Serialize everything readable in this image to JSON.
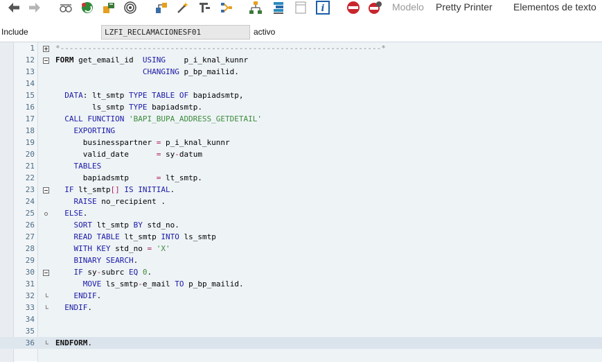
{
  "toolbar": {
    "icons": [
      "back-arrow-icon",
      "forward-arrow-icon",
      "display-change-icon",
      "other-object-icon",
      "activate-icon",
      "check-icon",
      "where-used-icon",
      "test-icon",
      "pattern-icon",
      "navigation-icon",
      "hierarchy-icon",
      "stack-icon",
      "frame-icon",
      "info-icon",
      "breakpoint-icon",
      "external-breakpoint-icon"
    ],
    "modelo_label": "Modelo",
    "pretty_printer_label": "Pretty Printer",
    "elementos_label": "Elementos de texto"
  },
  "info": {
    "include_label": "Include",
    "include_value": "LZFI_RECLAMACIONESF01",
    "status": "activo"
  },
  "editor": {
    "lines": [
      {
        "no": "1",
        "fold": "plus",
        "tokens": [
          {
            "t": "*----------------------------------------------------------------------*",
            "c": "cmt"
          }
        ]
      },
      {
        "no": "12",
        "fold": "minus",
        "tokens": [
          {
            "t": "FORM ",
            "c": "ef"
          },
          {
            "t": "get_email_id  ",
            "c": "black"
          },
          {
            "t": "USING",
            "c": "kw"
          },
          {
            "t": "    p_i_knal_kunnr",
            "c": "black"
          }
        ]
      },
      {
        "no": "13",
        "fold": "",
        "tokens": [
          {
            "t": "                   ",
            "c": "black"
          },
          {
            "t": "CHANGING",
            "c": "kw"
          },
          {
            "t": " p_bp_mailid.",
            "c": "black"
          }
        ]
      },
      {
        "no": "14",
        "fold": "",
        "tokens": []
      },
      {
        "no": "15",
        "fold": "",
        "tokens": [
          {
            "t": "  ",
            "c": "black"
          },
          {
            "t": "DATA",
            "c": "kw"
          },
          {
            "t": ": lt_smtp ",
            "c": "black"
          },
          {
            "t": "TYPE TABLE OF",
            "c": "kw"
          },
          {
            "t": " bapiadsmtp,",
            "c": "black"
          }
        ]
      },
      {
        "no": "16",
        "fold": "",
        "tokens": [
          {
            "t": "        ls_smtp ",
            "c": "black"
          },
          {
            "t": "TYPE",
            "c": "kw"
          },
          {
            "t": " bapiadsmtp.",
            "c": "black"
          }
        ]
      },
      {
        "no": "17",
        "fold": "",
        "tokens": [
          {
            "t": "  ",
            "c": "black"
          },
          {
            "t": "CALL FUNCTION",
            "c": "kw"
          },
          {
            "t": " ",
            "c": "black"
          },
          {
            "t": "'BAPI_BUPA_ADDRESS_GETDETAIL'",
            "c": "str"
          }
        ]
      },
      {
        "no": "18",
        "fold": "",
        "tokens": [
          {
            "t": "    ",
            "c": "black"
          },
          {
            "t": "EXPORTING",
            "c": "kw"
          }
        ]
      },
      {
        "no": "19",
        "fold": "",
        "tokens": [
          {
            "t": "      businesspartner ",
            "c": "black"
          },
          {
            "t": "=",
            "c": "op"
          },
          {
            "t": " p_i_knal_kunnr",
            "c": "black"
          }
        ]
      },
      {
        "no": "20",
        "fold": "",
        "tokens": [
          {
            "t": "      valid_date      ",
            "c": "black"
          },
          {
            "t": "=",
            "c": "op"
          },
          {
            "t": " sy",
            "c": "black"
          },
          {
            "t": "-",
            "c": "op"
          },
          {
            "t": "datum",
            "c": "black"
          }
        ]
      },
      {
        "no": "21",
        "fold": "",
        "tokens": [
          {
            "t": "    ",
            "c": "black"
          },
          {
            "t": "TABLES",
            "c": "kw"
          }
        ]
      },
      {
        "no": "22",
        "fold": "",
        "tokens": [
          {
            "t": "      bapiadsmtp      ",
            "c": "black"
          },
          {
            "t": "=",
            "c": "op"
          },
          {
            "t": " lt_smtp.",
            "c": "black"
          }
        ]
      },
      {
        "no": "23",
        "fold": "minus",
        "tokens": [
          {
            "t": "  ",
            "c": "black"
          },
          {
            "t": "IF",
            "c": "kw"
          },
          {
            "t": " lt_smtp",
            "c": "black"
          },
          {
            "t": "[]",
            "c": "op"
          },
          {
            "t": " ",
            "c": "black"
          },
          {
            "t": "IS INITIAL",
            "c": "kw"
          },
          {
            "t": ".",
            "c": "black"
          }
        ]
      },
      {
        "no": "24",
        "fold": "",
        "tokens": [
          {
            "t": "    ",
            "c": "black"
          },
          {
            "t": "RAISE",
            "c": "kw"
          },
          {
            "t": " no_recipient .",
            "c": "black"
          }
        ]
      },
      {
        "no": "25",
        "fold": "dot",
        "tokens": [
          {
            "t": "  ",
            "c": "black"
          },
          {
            "t": "ELSE",
            "c": "kw"
          },
          {
            "t": ".",
            "c": "black"
          }
        ]
      },
      {
        "no": "26",
        "fold": "",
        "tokens": [
          {
            "t": "    ",
            "c": "black"
          },
          {
            "t": "SORT",
            "c": "kw"
          },
          {
            "t": " lt_smtp ",
            "c": "black"
          },
          {
            "t": "BY",
            "c": "kw"
          },
          {
            "t": " std_no.",
            "c": "black"
          }
        ]
      },
      {
        "no": "27",
        "fold": "",
        "tokens": [
          {
            "t": "    ",
            "c": "black"
          },
          {
            "t": "READ TABLE",
            "c": "kw"
          },
          {
            "t": " lt_smtp ",
            "c": "black"
          },
          {
            "t": "INTO",
            "c": "kw"
          },
          {
            "t": " ls_smtp",
            "c": "black"
          }
        ]
      },
      {
        "no": "28",
        "fold": "",
        "tokens": [
          {
            "t": "    ",
            "c": "black"
          },
          {
            "t": "WITH KEY",
            "c": "kw"
          },
          {
            "t": " std_no ",
            "c": "black"
          },
          {
            "t": "=",
            "c": "op"
          },
          {
            "t": " ",
            "c": "black"
          },
          {
            "t": "'X'",
            "c": "str"
          }
        ]
      },
      {
        "no": "29",
        "fold": "",
        "tokens": [
          {
            "t": "    ",
            "c": "black"
          },
          {
            "t": "BINARY SEARCH",
            "c": "kw"
          },
          {
            "t": ".",
            "c": "black"
          }
        ]
      },
      {
        "no": "30",
        "fold": "minus",
        "tokens": [
          {
            "t": "    ",
            "c": "black"
          },
          {
            "t": "IF",
            "c": "kw"
          },
          {
            "t": " sy",
            "c": "black"
          },
          {
            "t": "-",
            "c": "op"
          },
          {
            "t": "subrc ",
            "c": "black"
          },
          {
            "t": "EQ",
            "c": "kw"
          },
          {
            "t": " ",
            "c": "black"
          },
          {
            "t": "0",
            "c": "num"
          },
          {
            "t": ".",
            "c": "black"
          }
        ]
      },
      {
        "no": "31",
        "fold": "",
        "tokens": [
          {
            "t": "      ",
            "c": "black"
          },
          {
            "t": "MOVE",
            "c": "kw"
          },
          {
            "t": " ls_smtp",
            "c": "black"
          },
          {
            "t": "-",
            "c": "op"
          },
          {
            "t": "e_mail ",
            "c": "black"
          },
          {
            "t": "TO",
            "c": "kw"
          },
          {
            "t": " p_bp_mailid.",
            "c": "black"
          }
        ]
      },
      {
        "no": "32",
        "fold": "end",
        "tokens": [
          {
            "t": "    ",
            "c": "black"
          },
          {
            "t": "ENDIF",
            "c": "kw"
          },
          {
            "t": ".",
            "c": "black"
          }
        ]
      },
      {
        "no": "33",
        "fold": "end",
        "tokens": [
          {
            "t": "  ",
            "c": "black"
          },
          {
            "t": "ENDIF",
            "c": "kw"
          },
          {
            "t": ".",
            "c": "black"
          }
        ]
      },
      {
        "no": "34",
        "fold": "",
        "tokens": []
      },
      {
        "no": "35",
        "fold": "",
        "tokens": []
      },
      {
        "no": "36",
        "fold": "endform",
        "hl": true,
        "tokens": [
          {
            "t": "ENDFORM",
            "c": "ef"
          },
          {
            "t": ".",
            "c": "black"
          }
        ]
      }
    ]
  }
}
